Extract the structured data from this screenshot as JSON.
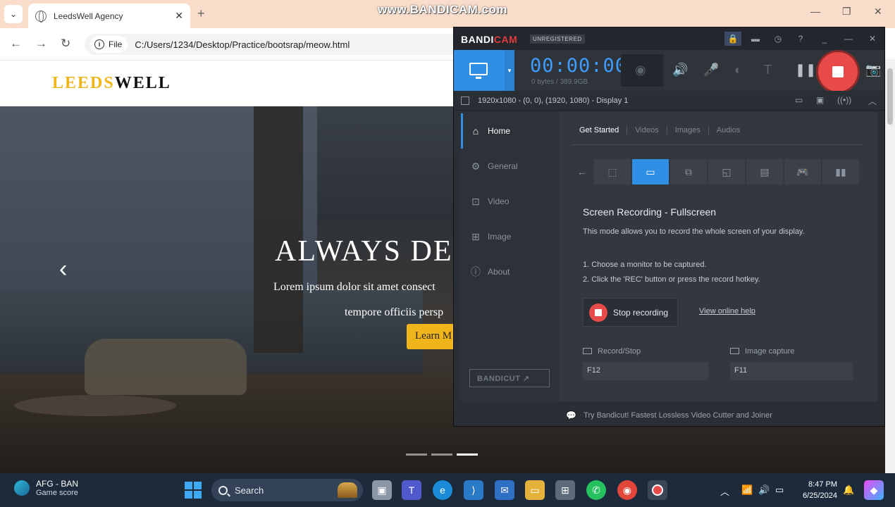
{
  "watermark": "www.BANDICAM.com",
  "browser": {
    "tab_title": "LeedsWell Agency",
    "new_tab_symbol": "+",
    "address_chip": "File",
    "url": "C:/Users/1234/Desktop/Practice/bootsrap/meow.html"
  },
  "site": {
    "logo_part1": "LEEDS",
    "logo_part2": "WELL",
    "hero_title": "ALWAYS DE",
    "hero_sub1": "Lorem ipsum dolor sit amet consect",
    "hero_sub2": "tempore officiis persp",
    "learn_more": "Learn M",
    "carousel_active_index": 2,
    "carousel_count": 3
  },
  "bandicam": {
    "brand_part1": "BANDI",
    "brand_part2": "CAM",
    "badge": "UNREGISTERED",
    "timer": "00:00:00",
    "bytes": "0 bytes / 389.9GB",
    "resolution": "1920x1080 - (0, 0), (1920, 1080) - Display 1",
    "nav": [
      {
        "label": "Home"
      },
      {
        "label": "General"
      },
      {
        "label": "Video"
      },
      {
        "label": "Image"
      },
      {
        "label": "About"
      }
    ],
    "bandicut_label": "BANDICUT ↗",
    "subtabs": [
      "Get Started",
      "Videos",
      "Images",
      "Audios"
    ],
    "heading": "Screen Recording - Fullscreen",
    "description": "This mode allows you to record the whole screen of your display.",
    "step1": "1. Choose a monitor to be captured.",
    "step2": "2. Click the 'REC' button or press the record hotkey.",
    "stop_label": "Stop recording",
    "help_link": "View online help",
    "hotkey_record_label": "Record/Stop",
    "hotkey_record_value": "F12",
    "hotkey_image_label": "Image capture",
    "hotkey_image_value": "F11",
    "footer": "Try Bandicut! Fastest Lossless Video Cutter and Joiner",
    "accent": "#2e8fe5",
    "rec_color": "#e84a4a"
  },
  "taskbar": {
    "weather_title": "AFG - BAN",
    "weather_sub": "Game score",
    "search_label": "Search",
    "time": "8:47 PM",
    "date": "6/25/2024"
  }
}
